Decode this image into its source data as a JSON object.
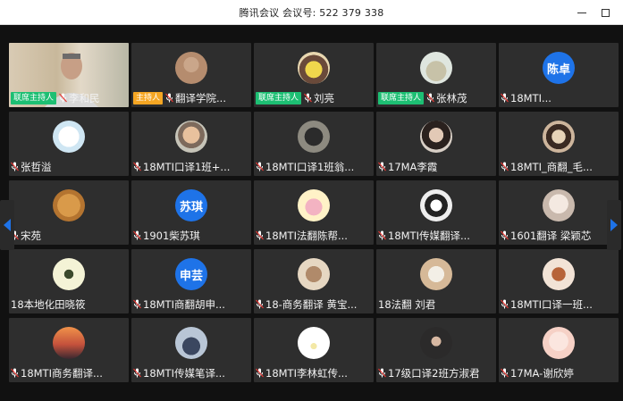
{
  "window": {
    "title": "腾讯会议 会议号: 522 379 338"
  },
  "badges": {
    "cohost": "联席主持人",
    "host": "主持人"
  },
  "colors": {
    "accent": "#1e73e8",
    "cohost_badge": "#1dbf73",
    "host_badge": "#f5a623",
    "tile_bg": "#2e2e2e"
  },
  "participants": [
    {
      "name": "李和民",
      "badge": "联席主持人",
      "avatar": "video"
    },
    {
      "name": "翻译学院...",
      "badge": "主持人",
      "avatar": "photo-figure"
    },
    {
      "name": "刘亮",
      "badge": "联席主持人",
      "avatar": "photo-cartoon"
    },
    {
      "name": "张林茂",
      "badge": "联席主持人",
      "avatar": "photo-building"
    },
    {
      "name": "18MTI...",
      "avatar_text": "陈卓"
    },
    {
      "name": "张哲溢",
      "avatar": "photo-white-figure"
    },
    {
      "name": "18MTI口译1班+...",
      "avatar": "photo-child"
    },
    {
      "name": "18MTI口译1班翁...",
      "avatar": "photo-bird"
    },
    {
      "name": "17MA李霞",
      "avatar": "photo-girl"
    },
    {
      "name": "18MTI_商翻_毛...",
      "avatar": "photo-cat"
    },
    {
      "name": "宋苑",
      "avatar": "photo-dog"
    },
    {
      "name": "1901柴苏琪",
      "avatar_text": "苏琪"
    },
    {
      "name": "18MTI法翻陈帮...",
      "avatar": "photo-pig"
    },
    {
      "name": "18MTI传媒翻译...",
      "avatar": "photo-bw"
    },
    {
      "name": "1601翻译 梁颖芯",
      "avatar": "photo-doll"
    },
    {
      "name": "18本地化田晓筱",
      "avatar": "photo-plant",
      "no_mic": true
    },
    {
      "name": "18MTI商翻胡申...",
      "avatar_text": "申芸"
    },
    {
      "name": "18-商务翻译 黄宝...",
      "avatar": "photo-food"
    },
    {
      "name": "18法翻 刘君",
      "avatar": "photo-panda",
      "no_mic": true
    },
    {
      "name": "18MTI口译一班...",
      "avatar": "photo-flower"
    },
    {
      "name": "18MTI商务翻译...",
      "avatar": "photo-sunset"
    },
    {
      "name": "18MTI传媒笔译...",
      "avatar": "photo-person"
    },
    {
      "name": "18MTI李林虹传...",
      "avatar": "photo-rainbow"
    },
    {
      "name": "17级口译2班方淑君",
      "avatar": "photo-dark-girl"
    },
    {
      "name": "17MA-谢欣婷",
      "avatar": "photo-anime"
    }
  ],
  "icons": {
    "mic": "microphone-muted-icon",
    "left_arrow": "page-left-icon",
    "right_arrow": "page-right-icon"
  }
}
